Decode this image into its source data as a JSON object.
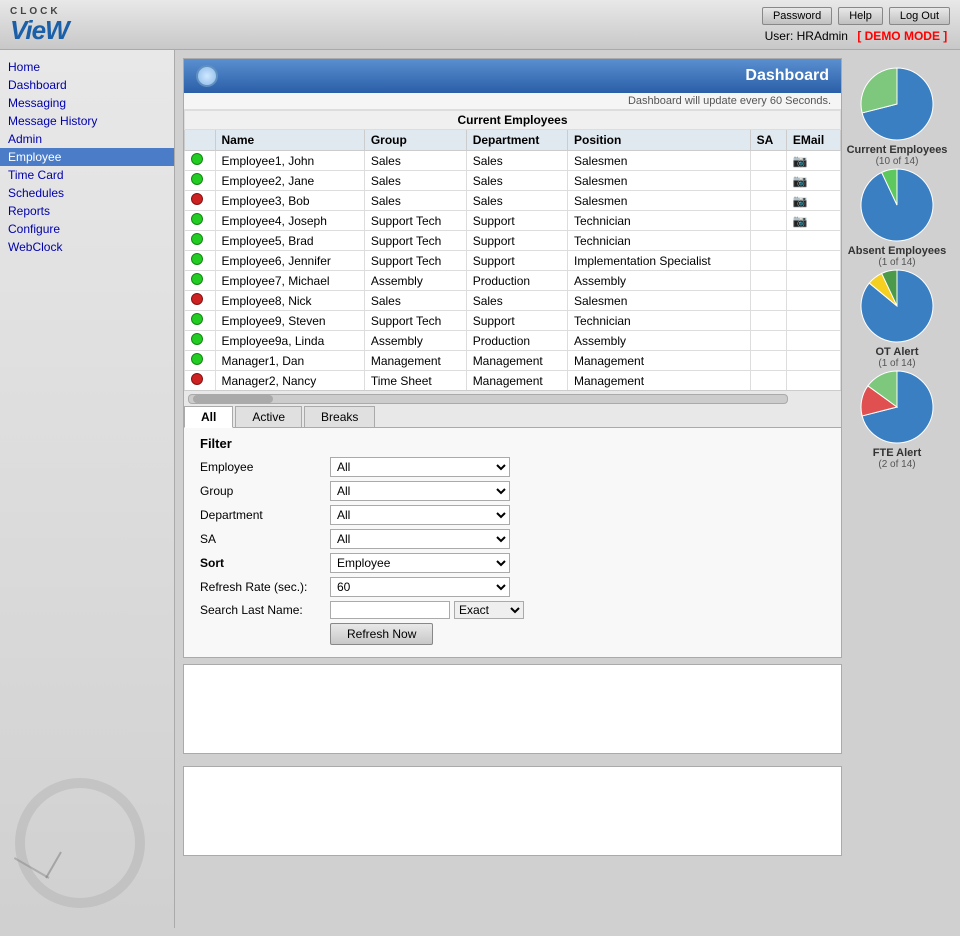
{
  "header": {
    "logo_clock": "CLOCK",
    "logo_view": "VieW",
    "buttons": [
      "Password",
      "Help",
      "Log Out"
    ],
    "user_label": "User: HRAdmin",
    "demo_mode": "[ DEMO MODE ]"
  },
  "sidebar": {
    "items": [
      {
        "label": "Home",
        "active": false
      },
      {
        "label": "Dashboard",
        "active": false
      },
      {
        "label": "Messaging",
        "active": false
      },
      {
        "label": "Message History",
        "active": false
      },
      {
        "label": "Admin",
        "active": false
      },
      {
        "label": "Employee",
        "active": true
      },
      {
        "label": "Time Card",
        "active": false
      },
      {
        "label": "Schedules",
        "active": false
      },
      {
        "label": "Reports",
        "active": false
      },
      {
        "label": "Configure",
        "active": false
      },
      {
        "label": "WebClock",
        "active": false
      }
    ]
  },
  "dashboard": {
    "title": "Dashboard",
    "update_notice": "Dashboard will update every 60 Seconds.",
    "section_title": "Current Employees",
    "table": {
      "headers": [
        "Name",
        "Group",
        "Department",
        "Position",
        "SA",
        "EMail"
      ],
      "rows": [
        {
          "status": "green",
          "name": "Employee1, John",
          "group": "Sales",
          "department": "Sales",
          "position": "Salesmen",
          "sa": "",
          "email": true
        },
        {
          "status": "green",
          "name": "Employee2, Jane",
          "group": "Sales",
          "department": "Sales",
          "position": "Salesmen",
          "sa": "",
          "email": true
        },
        {
          "status": "red",
          "name": "Employee3, Bob",
          "group": "Sales",
          "department": "Sales",
          "position": "Salesmen",
          "sa": "",
          "email": true
        },
        {
          "status": "green",
          "name": "Employee4, Joseph",
          "group": "Support Tech",
          "department": "Support",
          "position": "Technician",
          "sa": "",
          "email": true
        },
        {
          "status": "green",
          "name": "Employee5, Brad",
          "group": "Support Tech",
          "department": "Support",
          "position": "Technician",
          "sa": "",
          "email": false
        },
        {
          "status": "green",
          "name": "Employee6, Jennifer",
          "group": "Support Tech",
          "department": "Support",
          "position": "Implementation Specialist",
          "sa": "",
          "email": false
        },
        {
          "status": "green",
          "name": "Employee7, Michael",
          "group": "Assembly",
          "department": "Production",
          "position": "Assembly",
          "sa": "",
          "email": false
        },
        {
          "status": "red",
          "name": "Employee8, Nick",
          "group": "Sales",
          "department": "Sales",
          "position": "Salesmen",
          "sa": "",
          "email": false
        },
        {
          "status": "green",
          "name": "Employee9, Steven",
          "group": "Support Tech",
          "department": "Support",
          "position": "Technician",
          "sa": "",
          "email": false
        },
        {
          "status": "green",
          "name": "Employee9a, Linda",
          "group": "Assembly",
          "department": "Production",
          "position": "Assembly",
          "sa": "",
          "email": false
        },
        {
          "status": "green",
          "name": "Manager1, Dan",
          "group": "Management",
          "department": "Management",
          "position": "Management",
          "sa": "",
          "email": false
        },
        {
          "status": "red",
          "name": "Manager2, Nancy",
          "group": "Time Sheet",
          "department": "Management",
          "position": "Management",
          "sa": "",
          "email": false
        }
      ]
    },
    "tabs": [
      "All",
      "Active",
      "Breaks"
    ],
    "active_tab": "All",
    "filter": {
      "title": "Filter",
      "fields": [
        {
          "label": "Employee",
          "bold": false,
          "type": "select",
          "value": "All"
        },
        {
          "label": "Group",
          "bold": false,
          "type": "select",
          "value": "All"
        },
        {
          "label": "Department",
          "bold": false,
          "type": "select",
          "value": "All"
        },
        {
          "label": "SA",
          "bold": false,
          "type": "select",
          "value": "All"
        },
        {
          "label": "Sort",
          "bold": true,
          "type": "select",
          "value": "Employee"
        },
        {
          "label": "Refresh Rate (sec.):",
          "bold": false,
          "type": "select",
          "value": "60"
        },
        {
          "label": "Search Last Name:",
          "bold": false,
          "type": "input_exact",
          "value": ""
        }
      ],
      "refresh_btn": "Refresh Now"
    }
  },
  "charts": [
    {
      "label": "Current\nEmployees",
      "sublabel": "(10 of 14)",
      "type": "pie",
      "segments": [
        {
          "color": "#3a7fc1",
          "percent": 71
        },
        {
          "color": "#7dc87d",
          "percent": 29
        }
      ]
    },
    {
      "label": "Absent\nEmployees",
      "sublabel": "(1 of 14)",
      "type": "pie",
      "segments": [
        {
          "color": "#3a7fc1",
          "percent": 93
        },
        {
          "color": "#5dc85d",
          "percent": 7
        }
      ]
    },
    {
      "label": "OT Alert",
      "sublabel": "(1 of 14)",
      "type": "pie",
      "segments": [
        {
          "color": "#3a7fc1",
          "percent": 86
        },
        {
          "color": "#f5d020",
          "percent": 7
        },
        {
          "color": "#4a9a4a",
          "percent": 7
        }
      ]
    },
    {
      "label": "FTE Alert",
      "sublabel": "(2 of 14)",
      "type": "pie",
      "segments": [
        {
          "color": "#3a7fc1",
          "percent": 71
        },
        {
          "color": "#e05050",
          "percent": 14
        },
        {
          "color": "#7dc87d",
          "percent": 15
        }
      ]
    }
  ]
}
